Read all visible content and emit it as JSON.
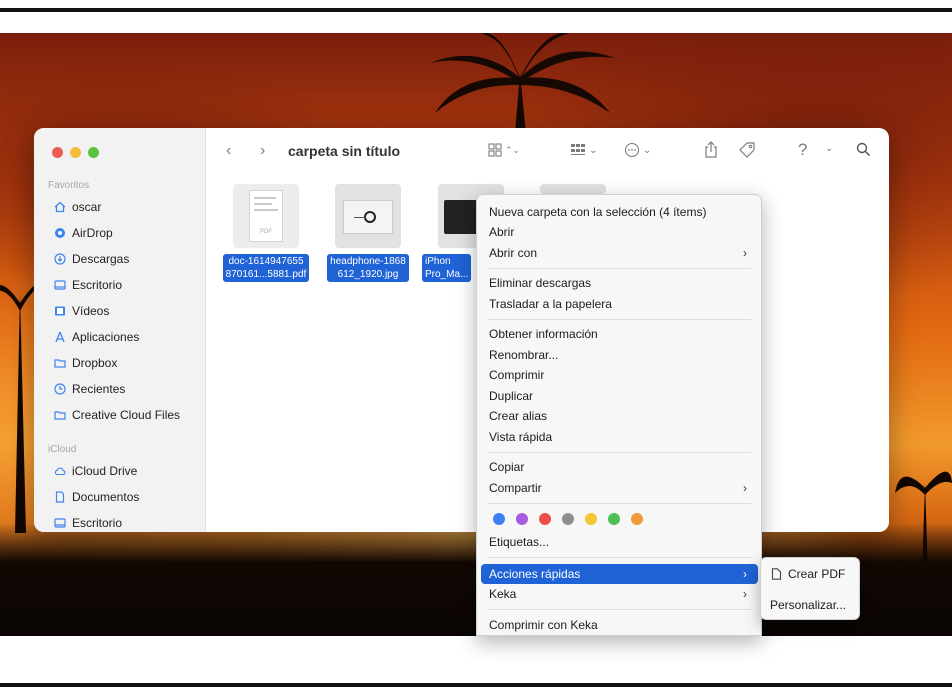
{
  "window": {
    "title": "carpeta sin título"
  },
  "sidebar": {
    "sections": [
      {
        "label": "Favoritos",
        "items": [
          {
            "label": "oscar",
            "icon": "home-icon"
          },
          {
            "label": "AirDrop",
            "icon": "airdrop-icon"
          },
          {
            "label": "Descargas",
            "icon": "download-icon"
          },
          {
            "label": "Escritorio",
            "icon": "desktop-icon"
          },
          {
            "label": "Vídeos",
            "icon": "film-icon"
          },
          {
            "label": "Aplicaciones",
            "icon": "apps-icon"
          },
          {
            "label": "Dropbox",
            "icon": "folder-icon"
          },
          {
            "label": "Recientes",
            "icon": "clock-icon"
          },
          {
            "label": "Creative Cloud Files",
            "icon": "folder-icon"
          }
        ]
      },
      {
        "label": "iCloud",
        "items": [
          {
            "label": "iCloud Drive",
            "icon": "cloud-icon"
          },
          {
            "label": "Documentos",
            "icon": "document-icon"
          },
          {
            "label": "Escritorio",
            "icon": "desktop-icon"
          }
        ]
      }
    ]
  },
  "files": [
    {
      "line1": "doc-1614947655",
      "line2": "870161...5881.pdf",
      "thumb_label": "PDF"
    },
    {
      "line1": "headphone-1868",
      "line2": "612_1920.jpg"
    },
    {
      "line1": "iPhon",
      "line2": "Pro_Ma..."
    }
  ],
  "context_menu": {
    "items_group1": [
      "Nueva carpeta con la selección (4 ítems)",
      "Abrir",
      "Abrir con"
    ],
    "items_group2": [
      "Eliminar descargas",
      "Trasladar a la papelera"
    ],
    "items_group3": [
      "Obtener información",
      "Renombrar...",
      "Comprimir",
      "Duplicar",
      "Crear alias",
      "Vista rápida"
    ],
    "items_group4": [
      "Copiar",
      "Compartir"
    ],
    "tag_colors": [
      "#3d7ef5",
      "#a65be0",
      "#ec4e47",
      "#8e8e8e",
      "#f6c633",
      "#4cc253",
      "#f29a38"
    ],
    "tags_label": "Etiquetas...",
    "quick_actions": "Acciones rápidas",
    "keka": "Keka",
    "compress_keka": "Comprimir con Keka",
    "chevron": "›"
  },
  "submenu": {
    "create_pdf": "Crear PDF",
    "customize": "Personalizar..."
  },
  "colors": {
    "accent": "#1f63d6",
    "sidebar_bg": "#f3f2f3"
  }
}
